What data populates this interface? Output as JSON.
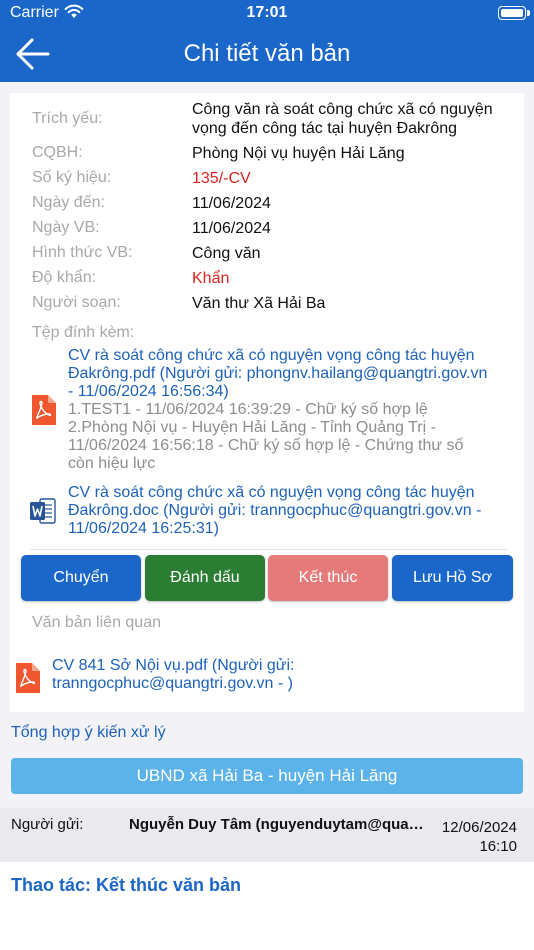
{
  "status_bar": {
    "carrier": "Carrier",
    "time": "17:01"
  },
  "nav": {
    "title": "Chi tiết văn bản"
  },
  "fields": [
    {
      "label": "Trích yếu:",
      "value": "Công văn rà soát công chức xã có nguyện vọng đến công tác tại huyện Đakrông"
    },
    {
      "label": "CQBH:",
      "value": "Phòng Nội vụ huyện Hải Lăng"
    },
    {
      "label": "Số ký hiệu:",
      "value": "135/-CV"
    },
    {
      "label": "Ngày đến:",
      "value": "11/06/2024"
    },
    {
      "label": "Ngày VB:",
      "value": "11/06/2024"
    },
    {
      "label": "Hình thức VB:",
      "value": "Công văn"
    },
    {
      "label": "Độ khẩn:",
      "value": "Khẩn"
    },
    {
      "label": "Người soạn:",
      "value": "Văn thư Xã Hải Ba"
    }
  ],
  "attachments": {
    "label": "Tệp đính kèm:",
    "items": [
      {
        "type": "pdf",
        "name": "CV rà soát công chức xã có nguyện vọng công tác huyện Đakrông.pdf (Người gửi: phongnv.hailang@quangtri.gov.vn - 11/06/2024 16:56:34)",
        "signatures": "1.TEST1 - 11/06/2024 16:39:29 - Chữ ký số hợp lệ 2.Phòng Nội vụ - Huyện Hải Lăng - Tỉnh Quảng Trị - 11/06/2024 16:56:18 - Chữ ký số hợp lệ - Chứng thư số còn hiệu lực"
      },
      {
        "type": "doc",
        "name": "CV rà soát công chức xã có nguyện vọng công tác huyện Đakrông.doc (Người gửi: tranngocphuc@quangtri.gov.vn - 11/06/2024 16:25:31)"
      }
    ]
  },
  "buttons": {
    "forward": "Chuyển",
    "mark": "Đánh dấu",
    "finish": "Kết thúc",
    "save": "Lưu Hồ Sơ"
  },
  "related": {
    "label": "Văn bản liên quan",
    "item": "CV 841 Sở Nội vụ.pdf (Người gửi: tranngocphuc@quangtri.gov.vn - )"
  },
  "summary_link": "Tổng hợp ý kiến xử lý",
  "department": "UBND xã Hải Ba - huyện Hải Lăng",
  "opinion": {
    "sender_label": "Người gửi:",
    "sender_name": "Nguyễn Duy Tâm (nguyenduytam@quangtri.gov.vn)",
    "date": "12/06/2024",
    "time": "16:10"
  },
  "action": "Thao tác: Kết thúc văn bản",
  "colors": {
    "primary": "#1a67c9",
    "green": "#2b7d34",
    "pink": "#e57a7a",
    "red_text": "#d7261f",
    "light_blue": "#5cb3e9"
  }
}
